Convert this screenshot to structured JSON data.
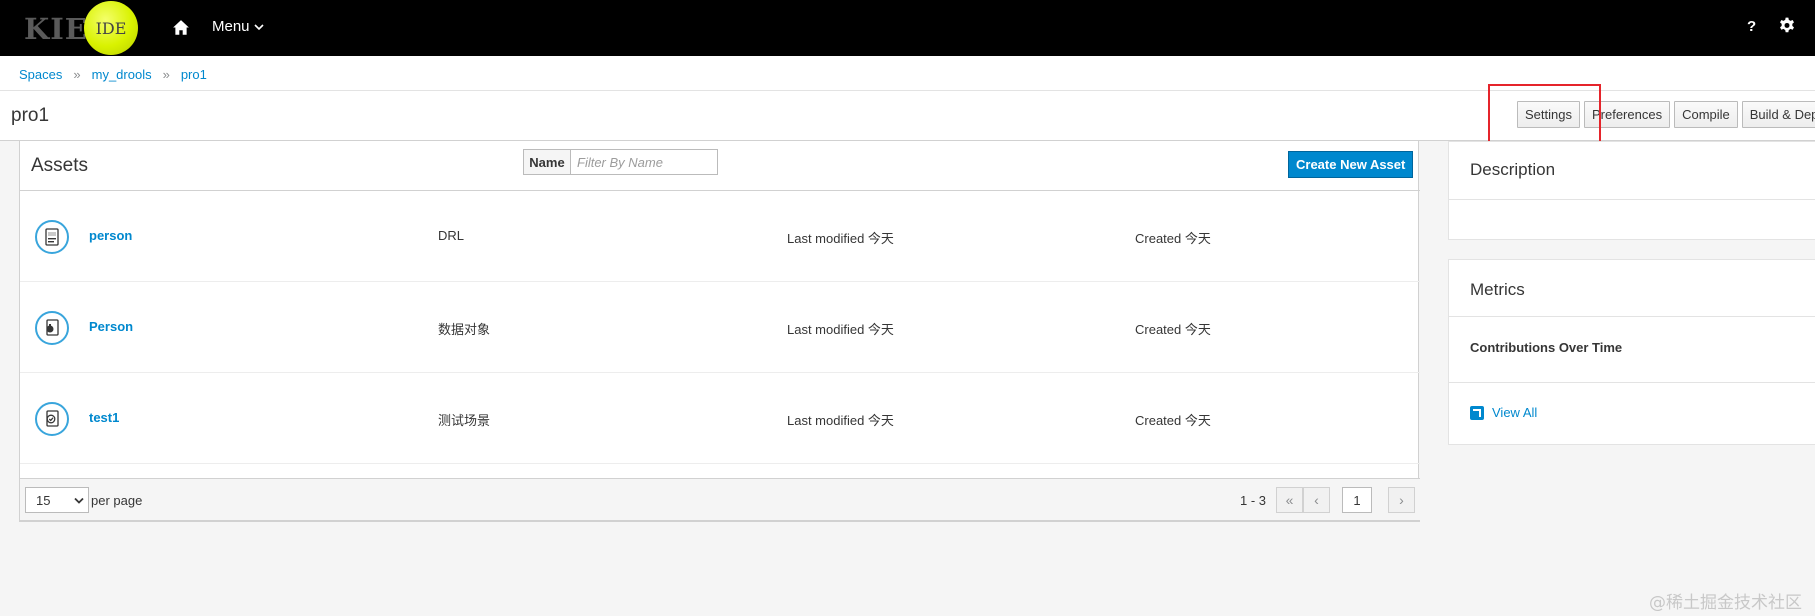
{
  "topbar": {
    "logo_kie": "KIE",
    "logo_ide": "IDE",
    "menu_label": "Menu",
    "help_label": "?"
  },
  "breadcrumb": {
    "items": [
      "Spaces",
      "my_drools",
      "pro1"
    ]
  },
  "page": {
    "title": "pro1"
  },
  "toolbar": {
    "settings": "Settings",
    "preferences": "Preferences",
    "compile": "Compile",
    "build_deploy": "Build & Deploy"
  },
  "assets": {
    "title": "Assets",
    "filter_label": "Name",
    "filter_placeholder": "Filter By Name",
    "create_button": "Create New Asset",
    "rows": [
      {
        "name": "person",
        "type": "DRL",
        "modified": "Last modified 今天",
        "created": "Created 今天",
        "icon": "drl-file-icon"
      },
      {
        "name": "Person",
        "type": "数据对象",
        "modified": "Last modified 今天",
        "created": "Created 今天",
        "icon": "data-object-icon"
      },
      {
        "name": "test1",
        "type": "测试场景",
        "modified": "Last modified 今天",
        "created": "Created 今天",
        "icon": "test-scenario-icon"
      }
    ]
  },
  "pager": {
    "per_page_value": "15",
    "per_page_label": "per page",
    "range": "1 - 3",
    "first_icon": "«",
    "prev_icon": "‹",
    "next_icon": "›",
    "current_page": "1"
  },
  "sidebar": {
    "description_title": "Description",
    "metrics_title": "Metrics",
    "contributions_label": "Contributions Over Time",
    "view_all_label": "View All"
  },
  "watermark": "@稀土掘金技术社区",
  "colors": {
    "accent": "#0088ce",
    "topbar": "#000000",
    "highlight": "#e5242b"
  }
}
